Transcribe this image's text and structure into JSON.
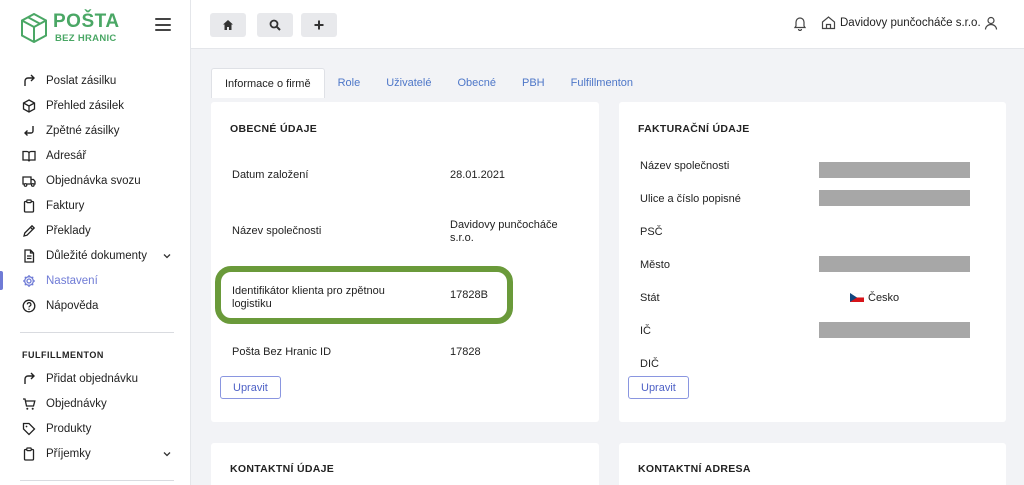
{
  "brand": {
    "title": "POŠTA",
    "subtitle": "BEZ HRANIC",
    "color": "#4aa765"
  },
  "sidebar": {
    "items": [
      {
        "label": "Poslat zásilku",
        "icon": "redo-arrow-icon"
      },
      {
        "label": "Přehled zásilek",
        "icon": "box-icon"
      },
      {
        "label": "Zpětné zásilky",
        "icon": "return-arrow-icon"
      },
      {
        "label": "Adresář",
        "icon": "book-icon"
      },
      {
        "label": "Objednávka svozu",
        "icon": "truck-icon"
      },
      {
        "label": "Faktury",
        "icon": "clipboard-icon"
      },
      {
        "label": "Překlady",
        "icon": "pen-icon"
      },
      {
        "label": "Důležité dokumenty",
        "icon": "document-icon"
      },
      {
        "label": "Nastavení",
        "icon": "gear-icon",
        "active": true
      },
      {
        "label": "Nápověda",
        "icon": "help-icon"
      }
    ],
    "section_title": "FULFILLMENTON",
    "fulfillment_items": [
      {
        "label": "Přidat objednávku",
        "icon": "redo-arrow-icon"
      },
      {
        "label": "Objednávky",
        "icon": "cart-icon"
      },
      {
        "label": "Produkty",
        "icon": "tag-icon"
      },
      {
        "label": "Příjemky",
        "icon": "clipboard-icon"
      }
    ],
    "accent": "#6f7bd6"
  },
  "topbar": {
    "company": "Davidovy punčocháče s.r.o."
  },
  "tabs": [
    "Informace o firmě",
    "Role",
    "Uživatelé",
    "Obecné",
    "PBH",
    "Fulfillmenton"
  ],
  "general": {
    "title": "OBECNÉ ÚDAJE",
    "rows": [
      {
        "label": "Datum založení",
        "value": "28.01.2021"
      },
      {
        "label": "Název společnosti",
        "value": "Davidovy punčocháče s.r.o."
      },
      {
        "label": "Identifikátor klienta pro zpětnou logistiku",
        "value": "17828B"
      },
      {
        "label": "Pošta Bez Hranic ID",
        "value": "17828"
      }
    ],
    "button": "Upravit"
  },
  "billing": {
    "title": "FAKTURAČNÍ ÚDAJE",
    "rows": [
      {
        "label": "Název společnosti"
      },
      {
        "label": "Ulice a číslo popisné"
      },
      {
        "label": "PSČ"
      },
      {
        "label": "Město"
      },
      {
        "label": "Stát",
        "value": "Česko"
      },
      {
        "label": "IČ"
      },
      {
        "label": "DIČ"
      }
    ],
    "button": "Upravit"
  },
  "contact": {
    "title": "KONTAKTNÍ ÚDAJE"
  },
  "contact_address": {
    "title": "KONTAKTNÍ ADRESA"
  },
  "highlight_color": "#6a9a3a"
}
